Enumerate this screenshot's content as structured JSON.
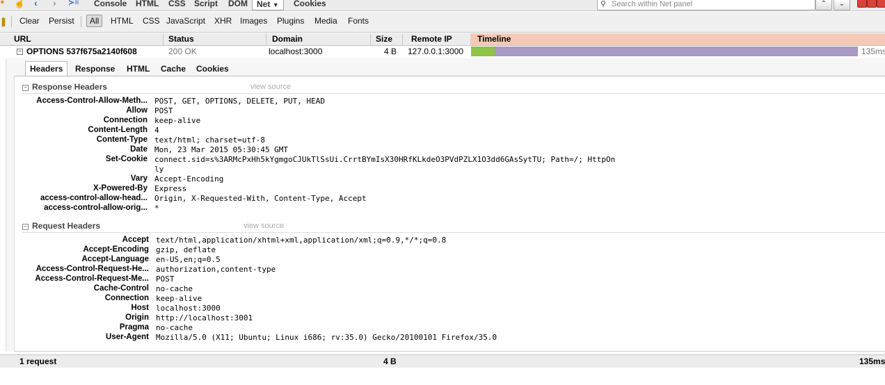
{
  "toolbar": {
    "tabs": [
      "Console",
      "HTML",
      "CSS",
      "Script",
      "DOM",
      "Net",
      "Cookies"
    ],
    "search_placeholder": "Search within Net panel"
  },
  "filters": {
    "clear": "Clear",
    "persist": "Persist",
    "types": [
      "All",
      "HTML",
      "CSS",
      "JavaScript",
      "XHR",
      "Images",
      "Plugins",
      "Media",
      "Fonts"
    ]
  },
  "columns": {
    "url": "URL",
    "status": "Status",
    "domain": "Domain",
    "size": "Size",
    "remote_ip": "Remote IP",
    "timeline": "Timeline"
  },
  "request": {
    "url": "OPTIONS 537f675a2140f608",
    "status": "200 OK",
    "domain": "localhost:3000",
    "size": "4 B",
    "remote_ip": "127.0.0.1:3000",
    "time": "135ms",
    "bar_color_wait": "#8fc24a",
    "bar_color_receive": "#a89ac5"
  },
  "detail_tabs": [
    "Headers",
    "Response",
    "HTML",
    "Cache",
    "Cookies"
  ],
  "response_headers": {
    "title": "Response Headers",
    "view_source": "view source",
    "rows": [
      {
        "name": "Access-Control-Allow-Meth...",
        "value": "POST, GET, OPTIONS, DELETE, PUT, HEAD"
      },
      {
        "name": "Allow",
        "value": "POST"
      },
      {
        "name": "Connection",
        "value": "keep-alive"
      },
      {
        "name": "Content-Length",
        "value": "4"
      },
      {
        "name": "Content-Type",
        "value": "text/html; charset=utf-8"
      },
      {
        "name": "Date",
        "value": "Mon, 23 Mar 2015 05:30:45 GMT"
      },
      {
        "name": "Set-Cookie",
        "value": "connect.sid=s%3ARMcPxHh5kYgmgoCJUkTlSsUi.CrrtBYmIsX30HRfKLkdeO3PVdPZLX1O3dd6GAsSytTU; Path=/; HttpOn\nly"
      },
      {
        "name": "Vary",
        "value": "Accept-Encoding"
      },
      {
        "name": "X-Powered-By",
        "value": "Express"
      },
      {
        "name": "access-control-allow-head...",
        "value": "Origin, X-Requested-With, Content-Type, Accept"
      },
      {
        "name": "access-control-allow-orig...",
        "value": "*"
      }
    ]
  },
  "request_headers": {
    "title": "Request Headers",
    "view_source": "view source",
    "rows": [
      {
        "name": "Accept",
        "value": "text/html,application/xhtml+xml,application/xml;q=0.9,*/*;q=0.8"
      },
      {
        "name": "Accept-Encoding",
        "value": "gzip, deflate"
      },
      {
        "name": "Accept-Language",
        "value": "en-US,en;q=0.5"
      },
      {
        "name": "Access-Control-Request-He...",
        "value": "authorization,content-type"
      },
      {
        "name": "Access-Control-Request-Me...",
        "value": "POST"
      },
      {
        "name": "Cache-Control",
        "value": "no-cache"
      },
      {
        "name": "Connection",
        "value": "keep-alive"
      },
      {
        "name": "Host",
        "value": "localhost:3000"
      },
      {
        "name": "Origin",
        "value": "http://localhost:3001"
      },
      {
        "name": "Pragma",
        "value": "no-cache"
      },
      {
        "name": "User-Agent",
        "value": "Mozilla/5.0 (X11; Ubuntu; Linux i686; rv:35.0) Gecko/20100101 Firefox/35.0"
      }
    ]
  },
  "footer": {
    "count": "1 request",
    "size": "4 B",
    "time": "135ms"
  }
}
